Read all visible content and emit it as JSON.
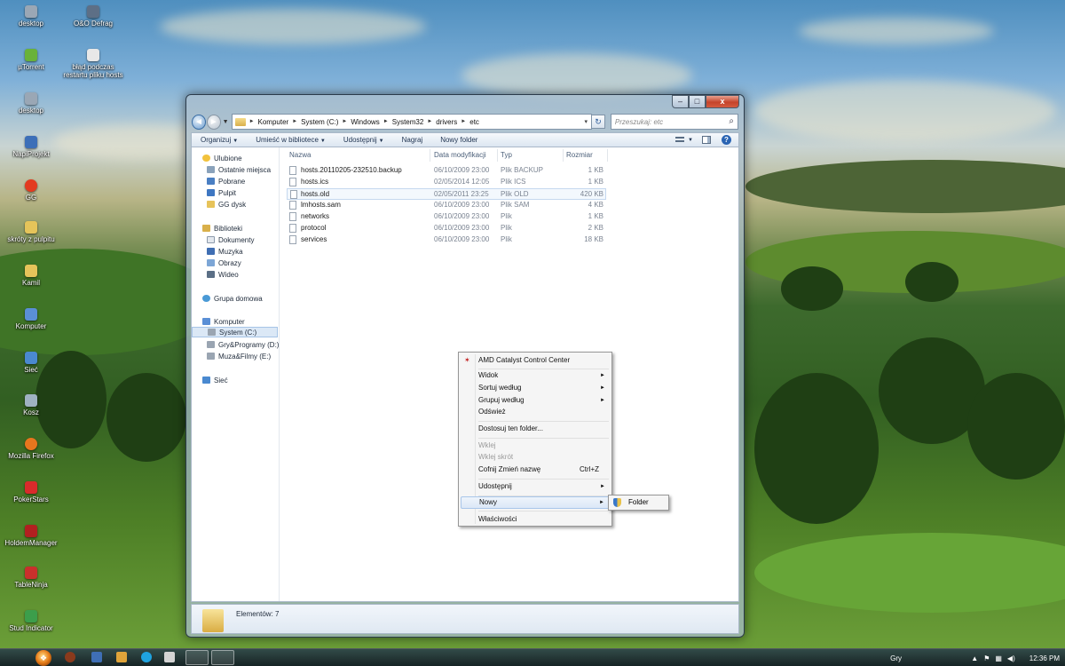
{
  "desktop": {
    "icons": [
      {
        "label": "desktop",
        "color": "#9aa7b5"
      },
      {
        "label": "O&O Defrag",
        "color": "#5d6f86"
      },
      {
        "label": "µTorrent",
        "color": "#69b23a"
      },
      {
        "label": "błąd podczas\nrestartu pliku hosts",
        "color": "#e8e8e8"
      },
      {
        "label": "desktop",
        "color": "#9aa7b5"
      },
      {
        "label": "NapiProjekt",
        "color": "#3d6fb8"
      },
      {
        "label": "GG",
        "color": "#e33a1f"
      },
      {
        "label": "skróty z pulpitu",
        "color": "#e5c45a"
      },
      {
        "label": "Kamil",
        "color": "#e5c45a"
      },
      {
        "label": "Komputer",
        "color": "#5a8fd6"
      },
      {
        "label": "Sieć",
        "color": "#4a89d0"
      },
      {
        "label": "Kosz",
        "color": "#9fb2c2"
      },
      {
        "label": "Mozilla Firefox",
        "color": "#e7761e"
      },
      {
        "label": "PokerStars",
        "color": "#d92b2b"
      },
      {
        "label": "HoldemManager",
        "color": "#b22020"
      },
      {
        "label": "TableNinja",
        "color": "#c9302c"
      },
      {
        "label": "Stud Indicator",
        "color": "#3c9e4b"
      }
    ]
  },
  "window": {
    "controls": {
      "min": "–",
      "max": "□",
      "close": "x"
    },
    "address": {
      "crumbs": [
        "Komputer",
        "System (C:)",
        "Windows",
        "System32",
        "drivers",
        "etc"
      ],
      "dropdown": "▾",
      "refresh": "↻"
    },
    "search": {
      "placeholder": "Przeszukaj: etc",
      "icon": "⌕"
    },
    "toolbar": {
      "organize": "Organizuj",
      "include": "Umieść w bibliotece",
      "share": "Udostępnij",
      "burn": "Nagraj",
      "new_folder": "Nowy folder",
      "help": "?"
    },
    "navpane": {
      "favorites": "Ulubione",
      "recent": "Ostatnie miejsca",
      "downloads": "Pobrane",
      "desktop": "Pulpit",
      "gg_disk": "GG dysk",
      "libraries": "Biblioteki",
      "documents": "Dokumenty",
      "music": "Muzyka",
      "pictures": "Obrazy",
      "videos": "Wideo",
      "homegroup": "Grupa domowa",
      "computer": "Komputer",
      "drive_c": "System (C:)",
      "drive_d": "Gry&Programy (D:)",
      "drive_e": "Muza&Filmy (E:)",
      "network": "Sieć"
    },
    "columns": {
      "name": "Nazwa",
      "date": "Data modyfikacji",
      "type": "Typ",
      "size": "Rozmiar"
    },
    "files": [
      {
        "name": "hosts.20110205-232510.backup",
        "date": "06/10/2009 23:00",
        "type": "Plik BACKUP",
        "size": "1 KB"
      },
      {
        "name": "hosts.ics",
        "date": "02/05/2014 12:05",
        "type": "Plik ICS",
        "size": "1 KB"
      },
      {
        "name": "hosts.old",
        "date": "02/05/2011 23:25",
        "type": "Plik OLD",
        "size": "420 KB"
      },
      {
        "name": "lmhosts.sam",
        "date": "06/10/2009 23:00",
        "type": "Plik SAM",
        "size": "4 KB"
      },
      {
        "name": "networks",
        "date": "06/10/2009 23:00",
        "type": "Plik",
        "size": "1 KB"
      },
      {
        "name": "protocol",
        "date": "06/10/2009 23:00",
        "type": "Plik",
        "size": "2 KB"
      },
      {
        "name": "services",
        "date": "06/10/2009 23:00",
        "type": "Plik",
        "size": "18 KB"
      }
    ],
    "status": {
      "items": "Elementów: 7"
    }
  },
  "context_menu": {
    "amd": "AMD Catalyst Control Center",
    "view": "Widok",
    "sort": "Sortuj według",
    "group": "Grupuj według",
    "refresh": "Odśwież",
    "customize": "Dostosuj ten folder...",
    "paste": "Wklej",
    "paste_shortcut": "Wklej skrót",
    "undo": "Cofnij Zmień nazwę",
    "undo_shortcut": "Ctrl+Z",
    "share": "Udostępnij",
    "new": "Nowy",
    "properties": "Właściwości",
    "submenu_folder": "Folder"
  },
  "taskbar": {
    "language": "Gry",
    "clock": "12:36 PM"
  }
}
